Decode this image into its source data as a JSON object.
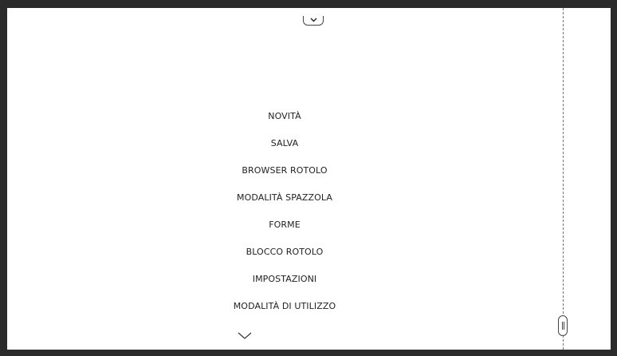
{
  "top_handle": {
    "icon": "chevron-down-icon"
  },
  "menu": {
    "items": [
      {
        "label": "NOVITÀ"
      },
      {
        "label": "SALVA"
      },
      {
        "label": "BROWSER ROTOLO"
      },
      {
        "label": "MODALITÀ SPAZZOLA"
      },
      {
        "label": "FORME"
      },
      {
        "label": "BLOCCO ROTOLO"
      },
      {
        "label": "IMPOSTAZIONI"
      },
      {
        "label": "MODALITÀ DI UTILIZZO"
      }
    ],
    "more_icon": "chevron-down-icon"
  },
  "roll": {
    "handle_icon": "grip-handle-icon"
  },
  "colors": {
    "frame": "#2b2b2b",
    "canvas": "#ffffff",
    "text": "#222222",
    "line": "#777777"
  }
}
